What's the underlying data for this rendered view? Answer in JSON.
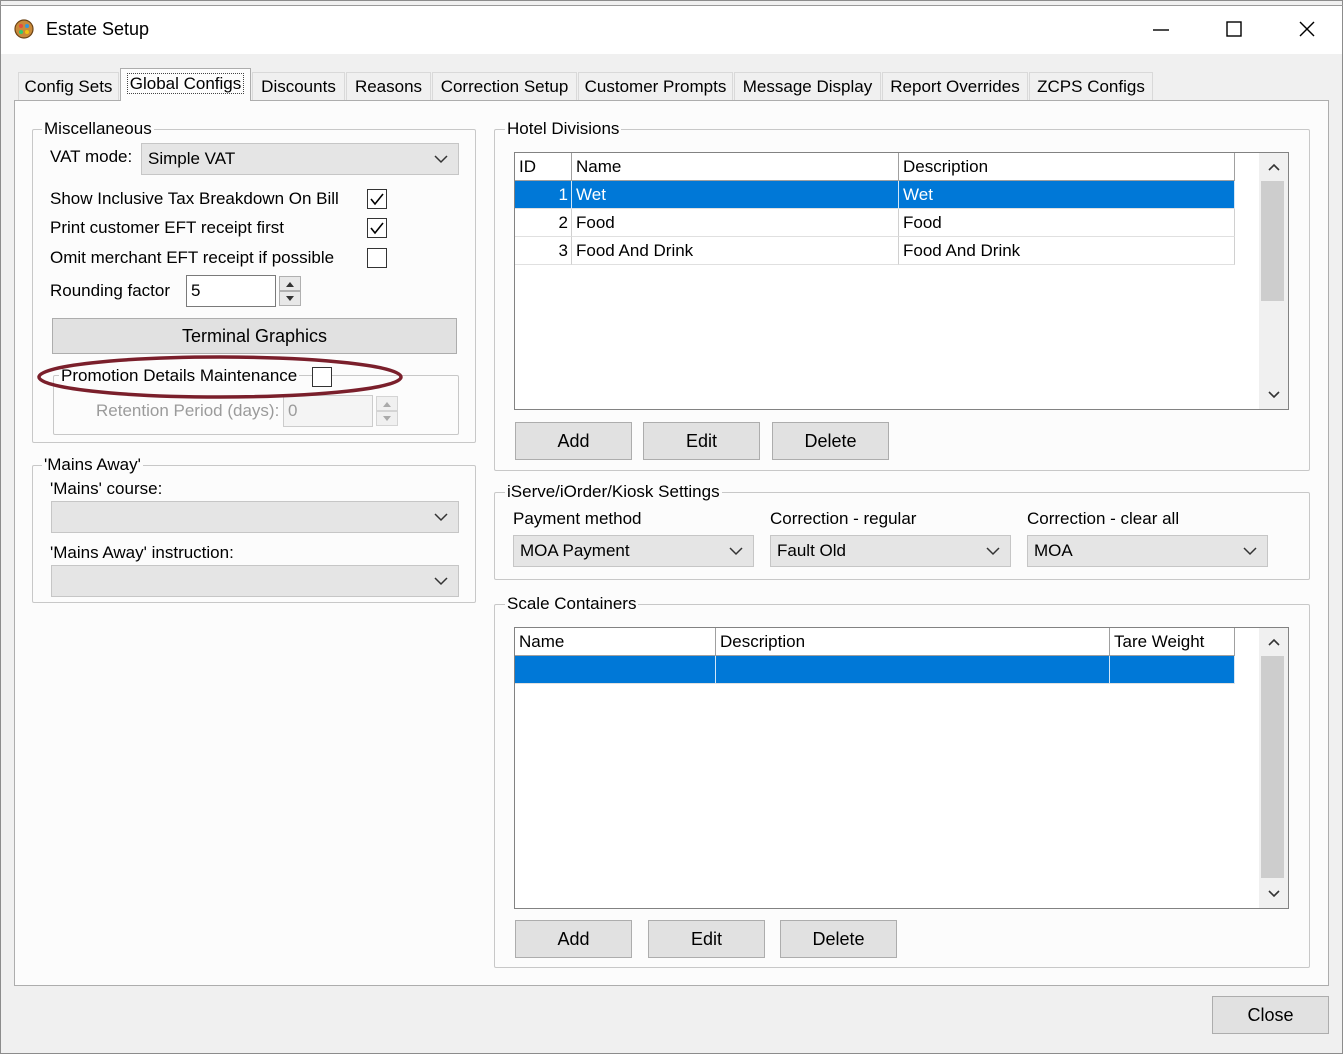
{
  "window": {
    "title": "Estate Setup"
  },
  "tabs": [
    {
      "label": "Config Sets"
    },
    {
      "label": "Global Configs"
    },
    {
      "label": "Discounts"
    },
    {
      "label": "Reasons"
    },
    {
      "label": "Correction Setup"
    },
    {
      "label": "Customer Prompts"
    },
    {
      "label": "Message Display"
    },
    {
      "label": "Report Overrides"
    },
    {
      "label": "ZCPS Configs"
    }
  ],
  "active_tab": "Global Configs",
  "misc": {
    "title": "Miscellaneous",
    "vat_label": "VAT mode:",
    "vat_value": "Simple VAT",
    "show_inclusive_label": "Show Inclusive Tax Breakdown On Bill",
    "print_customer_label": "Print customer EFT receipt first",
    "omit_merchant_label": "Omit merchant EFT receipt if possible",
    "rounding_label": "Rounding factor",
    "rounding_value": "5",
    "terminal_graphics": "Terminal Graphics",
    "promo_label": "Promotion Details Maintenance",
    "retention_label": "Retention Period (days):",
    "retention_value": "0"
  },
  "mains": {
    "title": "'Mains Away'",
    "course_label": "'Mains' course:",
    "instruction_label": "'Mains Away' instruction:"
  },
  "hotel": {
    "title": "Hotel Divisions",
    "columns": [
      "ID",
      "Name",
      "Description"
    ],
    "rows": [
      {
        "id": "1",
        "name": "Wet",
        "desc": "Wet"
      },
      {
        "id": "2",
        "name": "Food",
        "desc": "Food"
      },
      {
        "id": "3",
        "name": "Food And Drink",
        "desc": "Food And Drink"
      }
    ],
    "add": "Add",
    "edit": "Edit",
    "delete": "Delete"
  },
  "iserve": {
    "title": "iServe/iOrder/Kiosk Settings",
    "payment_label": "Payment method",
    "payment_value": "MOA Payment",
    "corr_regular_label": "Correction  - regular",
    "corr_regular_value": "Fault Old",
    "corr_clear_label": "Correction - clear all",
    "corr_clear_value": "MOA"
  },
  "scale": {
    "title": "Scale Containers",
    "columns": [
      "Name",
      "Description",
      "Tare Weight"
    ],
    "add": "Add",
    "edit": "Edit",
    "delete": "Delete"
  },
  "close": "Close",
  "colors": {
    "selection": "#0078d7",
    "highlight_ellipse": "#7a1f2b"
  }
}
